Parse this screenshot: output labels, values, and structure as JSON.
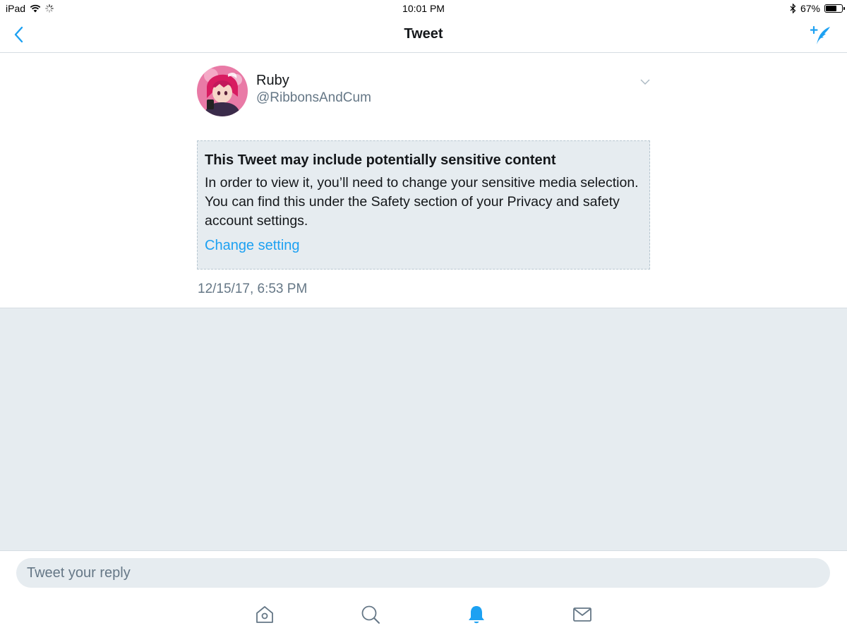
{
  "status_bar": {
    "device": "iPad",
    "time": "10:01 PM",
    "battery": "67%",
    "battery_level": 0.67
  },
  "nav": {
    "title": "Tweet",
    "back_icon": "chevron-left-icon",
    "compose_icon": "compose-tweet-icon"
  },
  "tweet": {
    "author_name": "Ruby",
    "author_handle": "@RibbonsAndCum",
    "sensitive_title": "This Tweet may include potentially sensitive content",
    "sensitive_body": "In order to view it, you’ll need to change your sensitive media selection. You can find this under the Safety section of your Privacy and safety account settings.",
    "change_setting_label": "Change setting",
    "timestamp": "12/15/17, 6:53 PM"
  },
  "reply": {
    "placeholder": "Tweet your reply"
  },
  "tab_bar": {
    "items": [
      "home-icon",
      "search-icon",
      "notifications-icon",
      "messages-icon"
    ],
    "active": "notifications-icon"
  },
  "colors": {
    "accent": "#1da1f2",
    "secondary_text": "#657786",
    "panel_bg": "#e6ecf0"
  }
}
